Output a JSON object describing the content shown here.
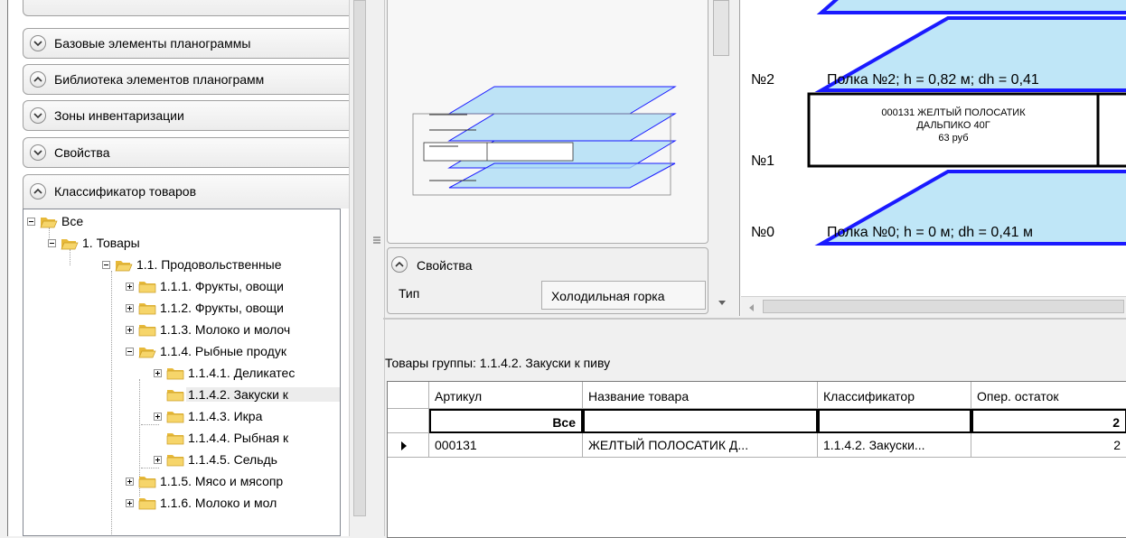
{
  "left_panel": {
    "accordion": [
      {
        "label": "Базовые элементы планограммы",
        "state": "collapsed"
      },
      {
        "label": "Библиотека элементов планограмм",
        "state": "expanded"
      },
      {
        "label": "Зоны инвентаризации",
        "state": "collapsed"
      },
      {
        "label": "Свойства",
        "state": "collapsed"
      },
      {
        "label": "Классификатор товаров",
        "state": "expanded"
      }
    ],
    "tree": [
      {
        "label": "Все",
        "level": 0,
        "expander": "minus",
        "folder": "open"
      },
      {
        "label": "1. Товары",
        "level": 1,
        "expander": "minus",
        "folder": "open"
      },
      {
        "label": "1.1. Продовольственные",
        "level": 2,
        "expander": "minus",
        "folder": "open"
      },
      {
        "label": "1.1.1. Фрукты, овощи",
        "level": 3,
        "expander": "plus",
        "folder": "closed"
      },
      {
        "label": "1.1.2. Фрукты, овощи",
        "level": 3,
        "expander": "plus",
        "folder": "closed"
      },
      {
        "label": "1.1.3. Молоко и молоч",
        "level": 3,
        "expander": "plus",
        "folder": "closed"
      },
      {
        "label": "1.1.4. Рыбные продук",
        "level": 3,
        "expander": "minus",
        "folder": "open"
      },
      {
        "label": "1.1.4.1. Деликатес",
        "level": 4,
        "expander": "plus",
        "folder": "closed"
      },
      {
        "label": "1.1.4.2. Закуски к",
        "level": 4,
        "expander": "none",
        "folder": "closed",
        "selected": true
      },
      {
        "label": "1.1.4.3. Икра",
        "level": 4,
        "expander": "plus",
        "folder": "closed"
      },
      {
        "label": "1.1.4.4. Рыбная к",
        "level": 4,
        "expander": "none",
        "folder": "closed"
      },
      {
        "label": "1.1.4.5. Сельдь",
        "level": 4,
        "expander": "plus",
        "folder": "closed"
      },
      {
        "label": "1.1.5. Мясо и мясопр",
        "level": 3,
        "expander": "plus",
        "folder": "closed"
      },
      {
        "label": "1.1.6. Молоко и мол",
        "level": 3,
        "expander": "plus",
        "folder": "closed"
      }
    ]
  },
  "properties": {
    "header": "Свойства",
    "type_label": "Тип",
    "type_value": "Холодильная горка"
  },
  "canvas": {
    "shelves": [
      {
        "number": "№2",
        "text": "Полка №2; h = 0,82 м; dh = 0,41"
      },
      {
        "number": "№1",
        "text": ""
      },
      {
        "number": "№0",
        "text": "Полка №0; h = 0 м; dh = 0,41 м"
      }
    ],
    "product_card": {
      "line1": "000131 ЖЕЛТЫЙ ПОЛОСАТИК",
      "line2": "ДАЛЬПИКО 40Г",
      "price": "63 руб"
    }
  },
  "group_label": "Товары группы: 1.1.4.2. Закуски к пиву",
  "table": {
    "columns": [
      "Артикул",
      "Название товара",
      "Классификатор",
      "Опер. остаток"
    ],
    "total_row": {
      "article": "Все",
      "name": "",
      "classifier": "",
      "stock": "2"
    },
    "rows": [
      {
        "article": "000131",
        "name": "ЖЕЛТЫЙ ПОЛОСАТИК Д...",
        "classifier": "1.1.4.2. Закуски...",
        "stock": "2"
      }
    ]
  },
  "colors": {
    "shelf_fill": "#bfe6f7",
    "shelf_edge": "#1a1aff",
    "accent": "#0000ff"
  }
}
